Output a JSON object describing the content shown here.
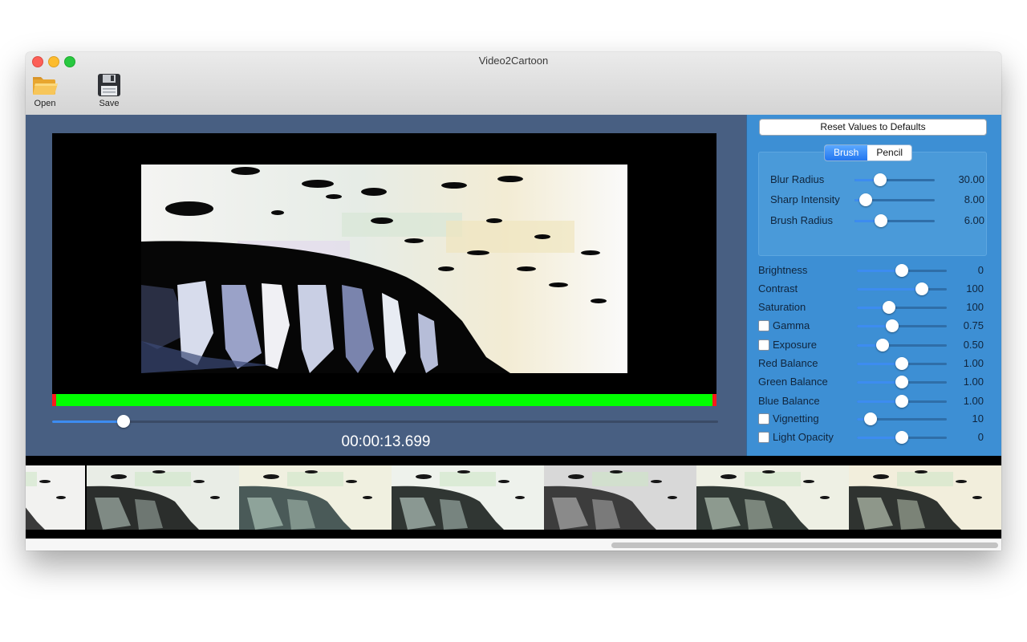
{
  "window": {
    "title": "Video2Cartoon"
  },
  "toolbar": {
    "open_label": "Open",
    "save_label": "Save"
  },
  "player": {
    "timecode": "00:00:13.699",
    "position_fraction": 0.107
  },
  "side": {
    "reset_label": "Reset Values to Defaults",
    "mode": {
      "options": [
        "Brush",
        "Pencil"
      ],
      "selected": "Brush"
    },
    "brush_params": [
      {
        "label": "Blur Radius",
        "value": "30.00",
        "level": 0.32
      },
      {
        "label": "Sharp Intensity",
        "value": "8.00",
        "level": 0.14
      },
      {
        "label": "Brush Radius",
        "value": "6.00",
        "level": 0.33
      }
    ],
    "adjustments": [
      {
        "label": "Brightness",
        "value": "0",
        "level": 0.5,
        "checkbox": false
      },
      {
        "label": "Contrast",
        "value": "100",
        "level": 0.72,
        "checkbox": false
      },
      {
        "label": "Saturation",
        "value": "100",
        "level": 0.36,
        "checkbox": false
      },
      {
        "label": "Gamma",
        "value": "0.75",
        "level": 0.39,
        "checkbox": true
      },
      {
        "label": "Exposure",
        "value": "0.50",
        "level": 0.29,
        "checkbox": true
      },
      {
        "label": "Red Balance",
        "value": "1.00",
        "level": 0.5,
        "checkbox": false
      },
      {
        "label": "Green Balance",
        "value": "1.00",
        "level": 0.5,
        "checkbox": false
      },
      {
        "label": "Blue Balance",
        "value": "1.00",
        "level": 0.5,
        "checkbox": false
      },
      {
        "label": "Vignetting",
        "value": "10",
        "level": 0.15,
        "checkbox": true
      },
      {
        "label": "Light Opacity",
        "value": "0",
        "level": 0.5,
        "checkbox": true
      }
    ]
  },
  "colors": {
    "video_bg": "#485f82",
    "side_bg": "#3d8fd4",
    "trim_bar": "#00ff00",
    "trim_marker": "#ff1a1a",
    "accent": "#3d8cf0"
  },
  "icons": {
    "open": "folder-icon",
    "save": "floppy-disk-icon"
  }
}
